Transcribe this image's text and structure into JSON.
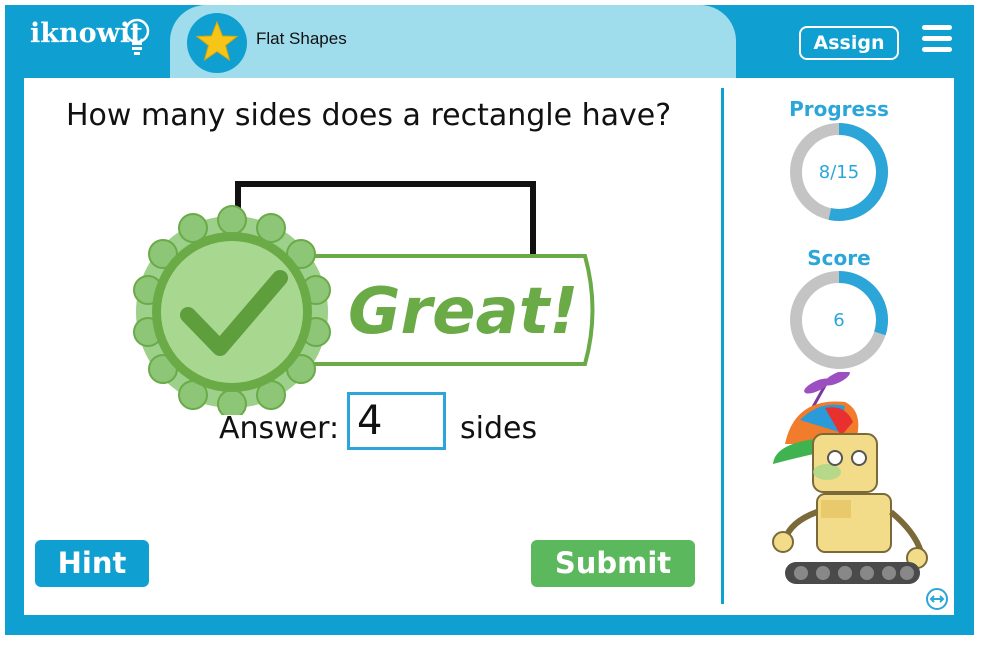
{
  "header": {
    "logo_text": "iknowit",
    "lesson_title": "Flat Shapes",
    "assign_label": "Assign",
    "menu_icon": "hamburger-menu-icon",
    "badge_icon": "star-icon"
  },
  "question": {
    "text": "How many sides does a rectangle have?",
    "feedback": "Great!"
  },
  "answer": {
    "label": "Answer:",
    "value": "4",
    "unit": "sides"
  },
  "buttons": {
    "hint": "Hint",
    "submit": "Submit"
  },
  "progress": {
    "label": "Progress",
    "text": "8/15",
    "current": 8,
    "total": 15
  },
  "score": {
    "label": "Score",
    "text": "6",
    "fraction": 0.3
  },
  "colors": {
    "brand_blue": "#0f9fd0",
    "header_light": "#9fdcec",
    "success_green": "#5cb85c",
    "badge_green": "#6aab47",
    "ring_gray": "#c4c4c4"
  }
}
